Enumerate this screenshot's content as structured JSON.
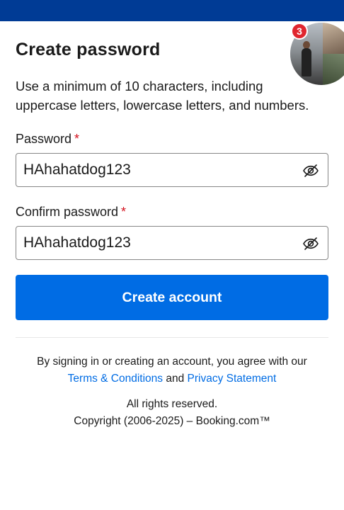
{
  "page": {
    "title": "Create password",
    "description": "Use a minimum of 10 characters, including uppercase letters, lowercase letters, and numbers."
  },
  "password_field": {
    "label": "Password",
    "required_mark": "*",
    "value": "HAhahatdog123",
    "toggle_icon": "eye-off-icon"
  },
  "confirm_field": {
    "label": "Confirm password",
    "required_mark": "*",
    "value": "HAhahatdog123",
    "toggle_icon": "eye-off-icon"
  },
  "submit": {
    "label": "Create account"
  },
  "footer": {
    "agreement_text": "By signing in or creating an account, you agree with our",
    "terms_link": "Terms & Conditions",
    "conjunction": "and",
    "privacy_link": "Privacy Statement",
    "rights": "All rights reserved.",
    "copyright": "Copyright (2006-2025) – Booking.com™"
  },
  "chat_head": {
    "badge_count": "3"
  },
  "colors": {
    "top_bar": "#003b95",
    "primary_button": "#006ce4",
    "link": "#006ce4",
    "required": "#d4111e",
    "badge": "#e0262f"
  }
}
